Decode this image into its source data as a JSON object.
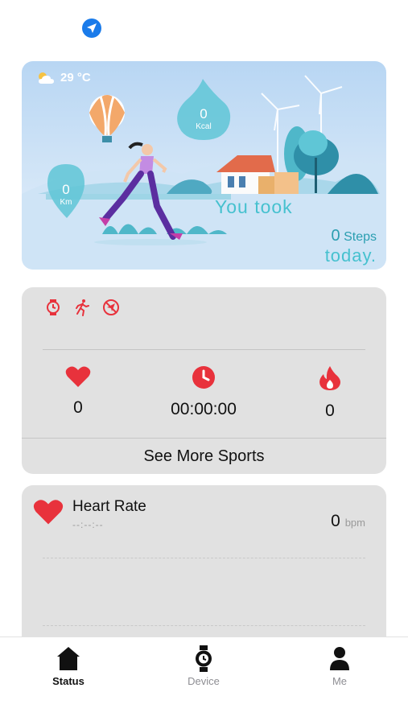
{
  "header": {
    "location_icon": "location-arrow-icon",
    "accent": "#1a7bea"
  },
  "hero": {
    "weather_icon": "partly-sunny-icon",
    "temperature": "29 °C",
    "calories": {
      "value": "0",
      "unit": "Kcal"
    },
    "distance": {
      "value": "0",
      "unit": "Km"
    },
    "you_took": "You took",
    "steps_value": "0",
    "steps_label": "Steps",
    "today": "today."
  },
  "sports": {
    "mode_icons": [
      "watch-icon",
      "running-icon",
      "no-gps-icon"
    ],
    "metrics": [
      {
        "icon": "heart-icon",
        "value": "0"
      },
      {
        "icon": "clock-icon",
        "value": "00:00:00"
      },
      {
        "icon": "flame-icon",
        "value": "0"
      }
    ],
    "see_more": "See More Sports",
    "accent": "#e8323c"
  },
  "heart_rate": {
    "title": "Heart Rate",
    "time": "--:--:--",
    "value": "0",
    "unit": "bpm"
  },
  "tabbar": {
    "tabs": [
      {
        "label": "Status",
        "icon": "home-icon",
        "active": true
      },
      {
        "label": "Device",
        "icon": "smartwatch-icon",
        "active": false
      },
      {
        "label": "Me",
        "icon": "person-icon",
        "active": false
      }
    ]
  }
}
